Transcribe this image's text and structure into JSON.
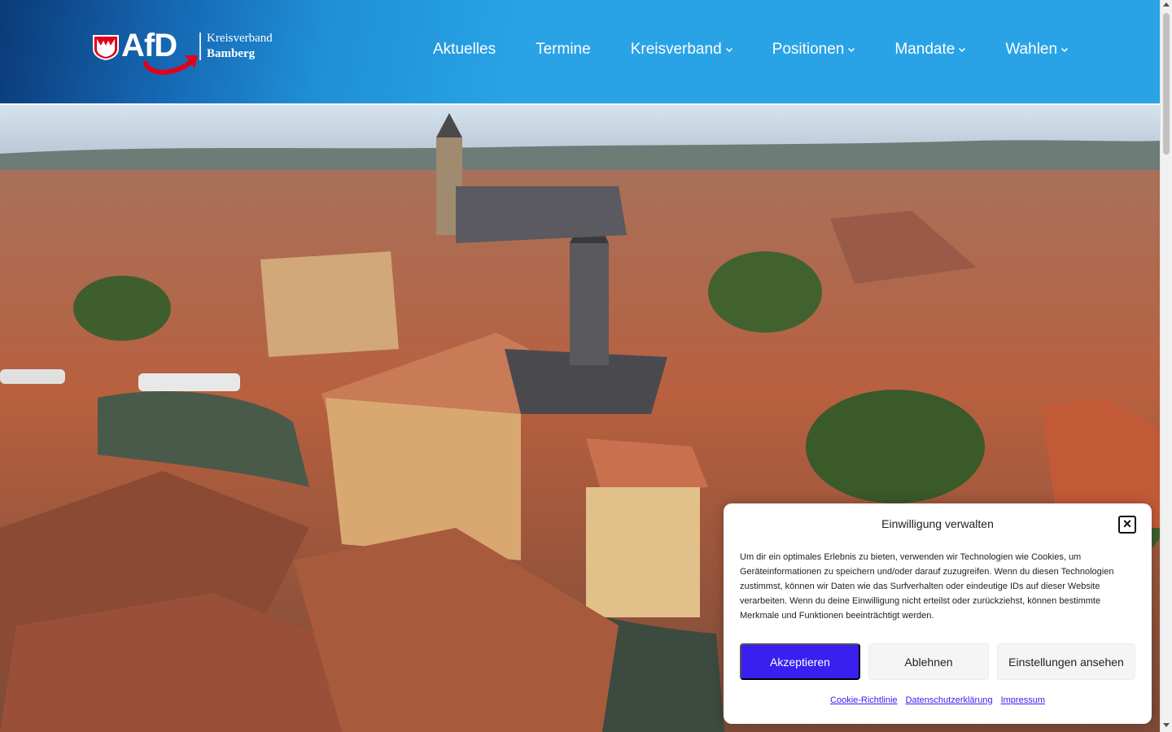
{
  "header": {
    "logo": {
      "brand": "AfD",
      "line1": "Kreisverband",
      "line2": "Bamberg"
    },
    "nav": [
      {
        "label": "Aktuelles",
        "has_dropdown": false
      },
      {
        "label": "Termine",
        "has_dropdown": false
      },
      {
        "label": "Kreisverband",
        "has_dropdown": true
      },
      {
        "label": "Positionen",
        "has_dropdown": true
      },
      {
        "label": "Mandate",
        "has_dropdown": true
      },
      {
        "label": "Wahlen",
        "has_dropdown": true
      }
    ]
  },
  "hero": {
    "image": "aerial-view-bamberg-old-town-hall"
  },
  "consent": {
    "title": "Einwilligung verwalten",
    "text": "Um dir ein optimales Erlebnis zu bieten, verwenden wir Technologien wie Cookies, um Geräteinformationen zu speichern und/oder darauf zuzugreifen. Wenn du diesen Technologien zustimmst, können wir Daten wie das Surfverhalten oder eindeutige IDs auf dieser Website verarbeiten. Wenn du deine Einwilligung nicht erteilst oder zurückziehst, können bestimmte Merkmale und Funktionen beeinträchtigt werden.",
    "accept_label": "Akzeptieren",
    "deny_label": "Ablehnen",
    "settings_label": "Einstellungen ansehen",
    "links": {
      "cookie": "Cookie-Richtlinie",
      "privacy": "Datenschutzerklärung",
      "imprint": "Impressum"
    }
  },
  "colors": {
    "header_blue": "#29a3e6",
    "header_dark": "#0b3a78",
    "brand_red": "#e2001a",
    "accept_button": "#3a20f0",
    "link": "#3a20f0"
  }
}
